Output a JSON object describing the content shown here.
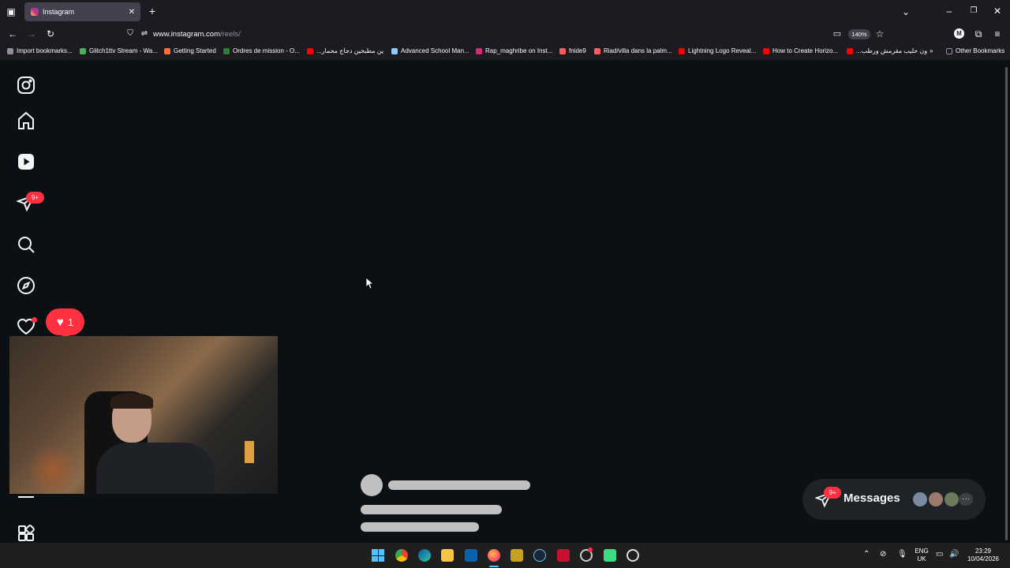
{
  "browser": {
    "tab_title": "Instagram",
    "url_host": "www.instagram.com",
    "url_path": "/reels/",
    "zoom": "140%",
    "profile_initial": "M"
  },
  "bookmarks": [
    {
      "label": "Import bookmarks...",
      "color": "#8f8f9d"
    },
    {
      "label": "Glitch1ttv Stream - Wa...",
      "color": "#4caf50"
    },
    {
      "label": "Getting Started",
      "color": "#ff7139"
    },
    {
      "label": "Ordres de mission - O...",
      "color": "#2e7d32"
    },
    {
      "label": "...ين مطبخين دجاج محمار",
      "color": "#ff0000"
    },
    {
      "label": "Advanced School Man...",
      "color": "#90caf9"
    },
    {
      "label": "Rap_maghribe on Inst...",
      "color": "#d62976"
    },
    {
      "label": "fnide9",
      "color": "#ff5a5f"
    },
    {
      "label": "Riad/villa dans la palm...",
      "color": "#ff5a5f"
    },
    {
      "label": "Lightning Logo Reveal...",
      "color": "#ff0000"
    },
    {
      "label": "How to Create Horizo...",
      "color": "#ff0000"
    },
    {
      "label": "...ون حليب مقرمش ورطب",
      "color": "#ff0000"
    },
    {
      "label": "Other Bookmarks",
      "color": "#8f8f9d"
    }
  ],
  "sidebar": {
    "messages_badge": "9+",
    "notification_count": "1"
  },
  "messages_widget": {
    "label": "Messages",
    "badge": "9+",
    "more": "···"
  },
  "taskbar": {
    "lang_line1": "ENG",
    "lang_line2": "UK",
    "time": "23:29",
    "date": "10/04/2026"
  },
  "colors": {
    "accent_red": "#ff3040",
    "background": "#0b1014"
  }
}
